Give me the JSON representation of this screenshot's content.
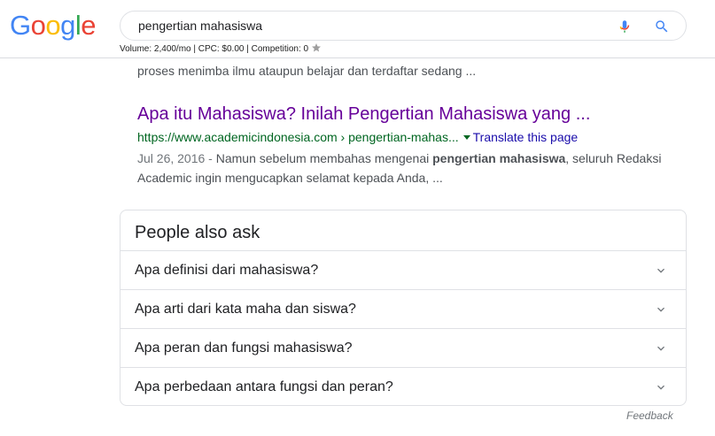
{
  "logo": {
    "letters": [
      "G",
      "o",
      "o",
      "g",
      "l",
      "e"
    ],
    "colors": [
      "#4285F4",
      "#EA4335",
      "#FBBC05",
      "#4285F4",
      "#34A853",
      "#EA4335"
    ]
  },
  "search": {
    "query": "pengertian mahasiswa"
  },
  "keyword_stats": {
    "text": "Volume: 2,400/mo | CPC: $0.00 | Competition: 0"
  },
  "previous_snippet": {
    "text": "proses menimba ilmu ataupun belajar dan terdaftar sedang ..."
  },
  "result": {
    "title": "Apa itu Mahasiswa? Inilah Pengertian Mahasiswa yang ...",
    "url": "https://www.academicindonesia.com › pengertian-mahas...",
    "translate_label": "Translate this page",
    "date": "Jul 26, 2016",
    "date_sep": " - ",
    "snippet_before": "Namun sebelum membahas mengenai ",
    "snippet_bold": "pengertian mahasiswa",
    "snippet_after": ", seluruh Redaksi Academic ingin mengucapkan selamat kepada Anda, ..."
  },
  "people_also_ask": {
    "title": "People also ask",
    "questions": [
      "Apa definisi dari mahasiswa?",
      "Apa arti dari kata maha dan siswa?",
      "Apa peran dan fungsi mahasiswa?",
      "Apa perbedaan antara fungsi dan peran?"
    ]
  },
  "feedback_label": "Feedback",
  "icons": {
    "mic": "mic-icon",
    "search": "search-icon",
    "star": "star-icon",
    "chevron": "chevron-down-icon"
  },
  "colors": {
    "link_visited": "#660099",
    "url_green": "#006621",
    "link_blue": "#1a0dab",
    "snippet_gray": "#4d5156"
  }
}
